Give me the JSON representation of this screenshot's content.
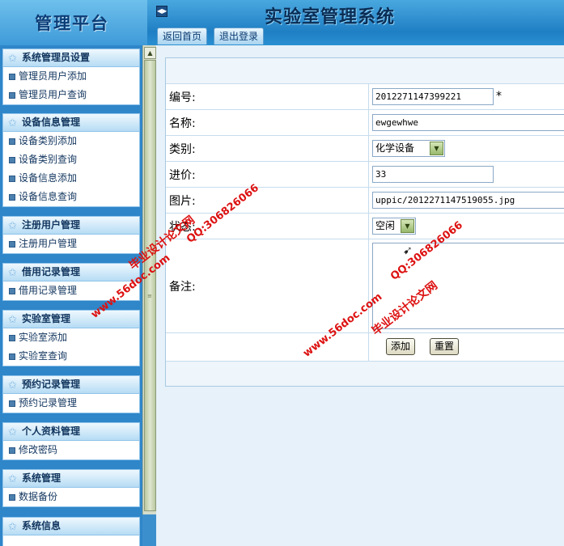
{
  "header": {
    "logo": "管理平台",
    "system_title": "实验室管理系统",
    "toggle_glyph": "◀▶",
    "tabs": [
      {
        "label": "返回首页"
      },
      {
        "label": "退出登录"
      }
    ]
  },
  "sidebar": {
    "groups": [
      {
        "title": "系统管理员设置",
        "items": [
          "管理员用户添加",
          "管理员用户查询"
        ]
      },
      {
        "title": "设备信息管理",
        "items": [
          "设备类别添加",
          "设备类别查询",
          "设备信息添加",
          "设备信息查询"
        ]
      },
      {
        "title": "注册用户管理",
        "items": [
          "注册用户管理"
        ]
      },
      {
        "title": "借用记录管理",
        "items": [
          "借用记录管理"
        ]
      },
      {
        "title": "实验室管理",
        "items": [
          "实验室添加",
          "实验室查询"
        ]
      },
      {
        "title": "预约记录管理",
        "items": [
          "预约记录管理"
        ]
      },
      {
        "title": "个人资料管理",
        "items": [
          "修改密码"
        ]
      },
      {
        "title": "系统管理",
        "items": [
          "数据备份"
        ]
      },
      {
        "title": "系统信息",
        "items": []
      }
    ]
  },
  "form": {
    "fields": {
      "code": {
        "label": "编号:",
        "value": "2012271147399221",
        "required_mark": "*"
      },
      "name": {
        "label": "名称:",
        "value": "ewgewhwe"
      },
      "category": {
        "label": "类别:",
        "value": "化学设备"
      },
      "price": {
        "label": "进价:",
        "value": "33"
      },
      "image": {
        "label": "图片:",
        "value": "uppic/2012271147519055.jpg"
      },
      "status": {
        "label": "状态:",
        "value": "空闲"
      },
      "notes": {
        "label": "备注:",
        "value": ""
      }
    },
    "buttons": {
      "add": "添加",
      "reset": "重置"
    }
  },
  "watermark": {
    "site": "www.56doc.com",
    "qq": "QQ:306826066",
    "name": "毕业设计论文网"
  }
}
